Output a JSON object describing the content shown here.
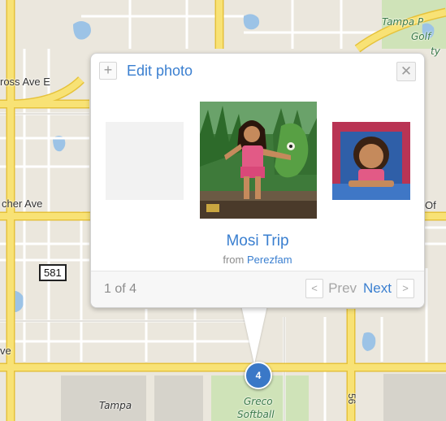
{
  "map": {
    "labels": {
      "ross_ave": "ross Ave E",
      "cher_ave": "cher Ave",
      "of": "Of",
      "route_581": "581",
      "ve": "ve",
      "tampa_top": "Tampa P",
      "golf": "Golf",
      "ty": "ty",
      "tampa_bottom": "Tampa",
      "greco": "Greco",
      "softball": "Softball",
      "vertical_road": "56"
    },
    "marker_count": "4",
    "colors": {
      "major_road": "#f5dc55",
      "minor_road": "#ffffff",
      "water": "#9cc3e6",
      "park": "#cfe3b8"
    }
  },
  "popup": {
    "add_icon": "+",
    "edit_label": "Edit photo",
    "close_icon": "✕",
    "photo_title": "Mosi Trip",
    "from_prefix": "from",
    "author": "Perezfam",
    "counter": "1 of 4",
    "prev_icon": "<",
    "prev_label": "Prev",
    "next_label": "Next",
    "next_icon": ">"
  }
}
